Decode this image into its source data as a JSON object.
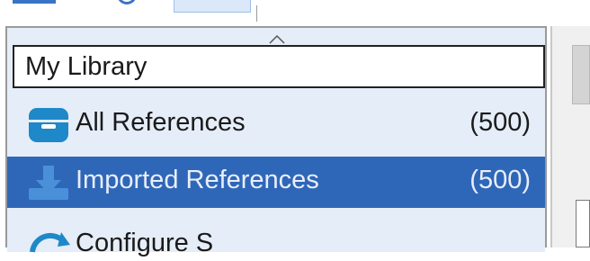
{
  "library": {
    "title": "My Library",
    "items": [
      {
        "label": "All References",
        "count": "(500)",
        "icon": "library-box-icon",
        "selected": false
      },
      {
        "label": "Imported References",
        "count": "(500)",
        "icon": "import-download-icon",
        "selected": true
      },
      {
        "label": "Configure S",
        "count": "",
        "icon": "sync-icon",
        "selected": false
      }
    ]
  },
  "colors": {
    "panel_bg": "#e5edf8",
    "selected_bg": "#2f67b8",
    "icon_blue": "#1e88c8",
    "accent": "#3a74c4"
  }
}
